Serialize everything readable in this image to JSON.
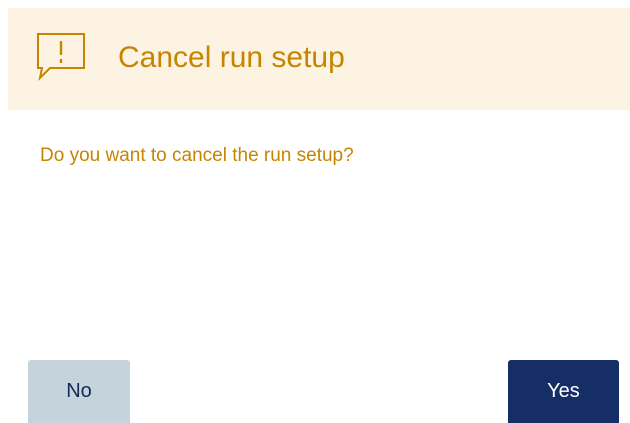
{
  "dialog": {
    "title": "Cancel run setup",
    "icon": "speech-exclamation-icon",
    "message": "Do you want to cancel the run setup?",
    "buttons": {
      "no_label": "No",
      "yes_label": "Yes"
    }
  },
  "colors": {
    "accent": "#c58500",
    "header_bg": "#fdf3e2",
    "no_bg": "#c5d3dc",
    "yes_bg": "#152f66"
  }
}
